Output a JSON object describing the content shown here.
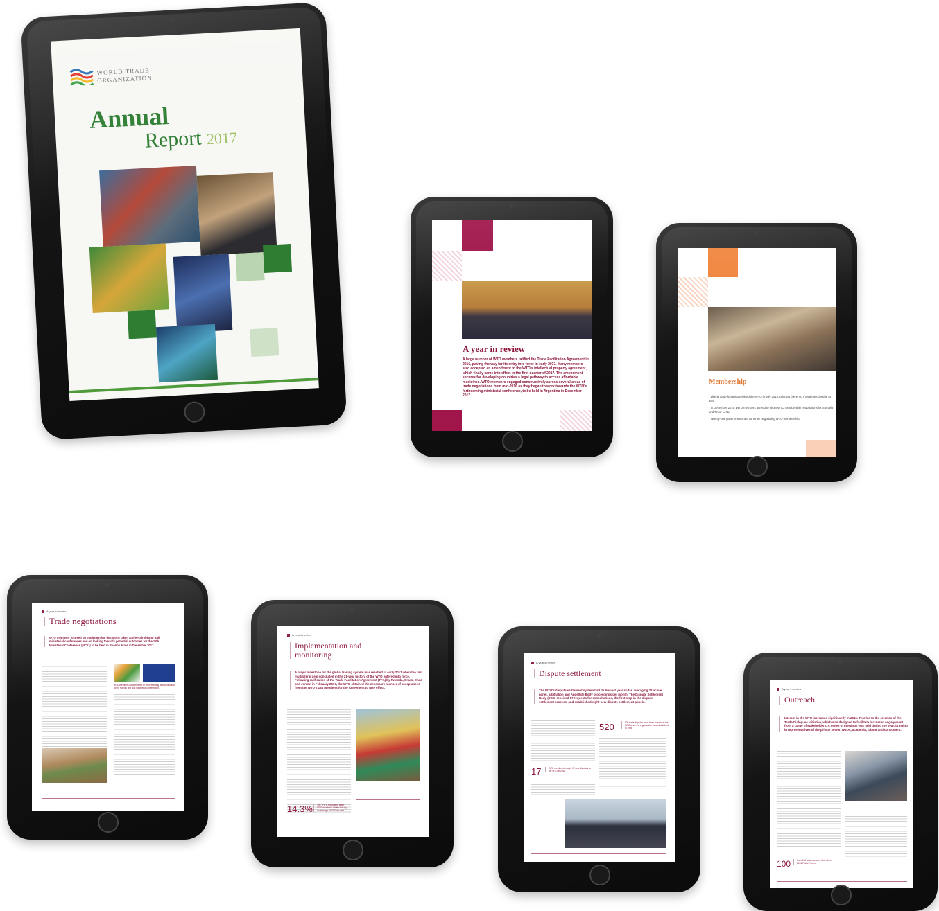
{
  "cover": {
    "org_name_line1": "WORLD TRADE",
    "org_name_line2": "ORGANIZATION",
    "title_line1": "Annual",
    "title_line2": "Report",
    "year": "2017"
  },
  "year_in_review": {
    "heading": "A year in review",
    "body": "A large number of WTO members ratified the Trade Facilitation Agreement in 2016, paving the way for its entry into force in early 2017. Many members also accepted an amendment to the WTO's intellectual property agreement, which finally came into effect in the first quarter of 2017. The amendment secures for developing countries a legal pathway to access affordable medicines. WTO members engaged constructively across several areas of trade negotiations from mid-2016 as they began to work towards the WTO's forthcoming ministerial conference, to be held in Argentina in December 2017."
  },
  "membership": {
    "heading": "Membership",
    "bullets": [
      "Liberia and Afghanistan joined the WTO in July 2016, bringing the WTO's total membership to 164.",
      "In December 2016, WTO members agreed to begin WTO membership negotiations for Somalia and Timor-Leste.",
      "Twenty-one governments are currently negotiating WTO membership."
    ]
  },
  "trade_negotiations": {
    "kicker": "A year in review",
    "title": "Trade negotiations",
    "lead": "WTO members focused on implementing decisions taken at the Nairobi and Bali ministerial conferences and on looking towards potential outcomes for the 11th Ministerial Conference (MC11) to be held in Buenos Aires in December 2017.",
    "caption": "WTO members concentrated on implementing decisions taken at the Nairobi and Bali ministerial conferences."
  },
  "implementation": {
    "kicker": "A year in review",
    "title_line1": "Implementation and",
    "title_line2": "monitoring",
    "lead": "A major milestone for the global trading system was reached in early 2017 when the first multilateral deal concluded in the 21-year history of the WTO entered into force. Following ratification of the Trade Facilitation Agreement (TFA) by Rwanda, Oman, Chad and Jordan in February 2017, the WTO obtained the necessary number of acceptances from the WTO's 164 members for the Agreement to take effect.",
    "stat_value": "14.3%",
    "stat_label": "The TFA is forecast to slash WTO members' trade costs by an average of 14.3 per cent."
  },
  "dispute": {
    "kicker": "A year in review",
    "title": "Dispute settlement",
    "lead": "The WTO's dispute settlement system had its busiest year so far, averaging 22 active panel, arbitration and Appellate Body proceedings per month. The Dispute Settlement Body (DSB) received 17 requests for consultations, the first step in the dispute settlement process, and established eight new dispute settlement panels.",
    "stat1_value": "520",
    "stat1_label": "520 trade disputes have been brought to the WTO since the organization was established in 1995.",
    "stat2_value": "17",
    "stat2_label": "WTO members brought 17 new disputes to the WTO in 2016."
  },
  "outreach": {
    "kicker": "A year in review",
    "title": "Outreach",
    "lead": "Interest in the WTO increased significantly in 2016. This led to the creation of the Trade Dialogues initiative, which was designed to facilitate increased engagement from a range of stakeholders. A series of meetings was held during the year, bringing in representatives of the private sector, NGOs, academia, labour and consumers.",
    "stat_value": "100",
    "stat_label": "Over 100 sessions were held at the 2016 Public Forum."
  },
  "colors": {
    "maroon": "#8a1538",
    "magenta": "#b0124f",
    "orange": "#f0843c",
    "cover_green": "#2e7d32"
  }
}
